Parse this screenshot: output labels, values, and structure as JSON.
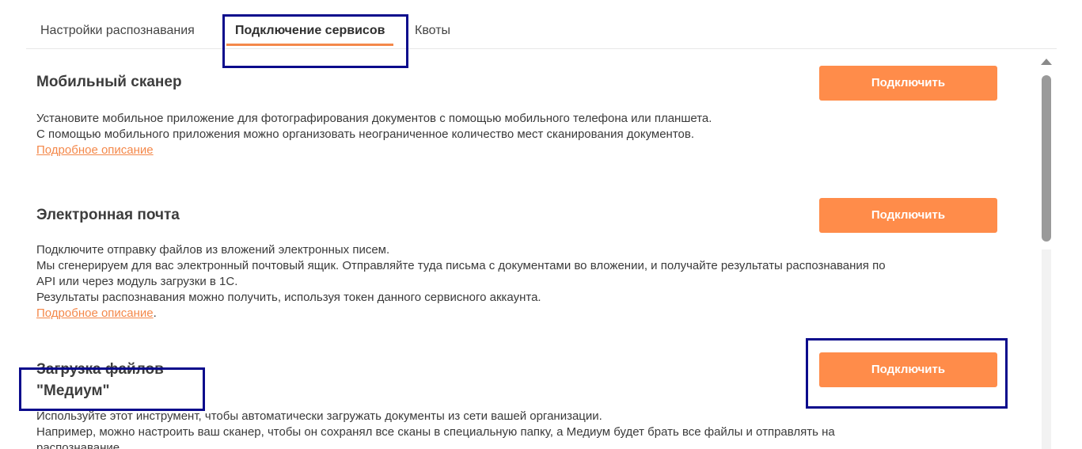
{
  "tabs": {
    "recognition_settings": "Настройки распознавания",
    "service_connection": "Подключение сервисов",
    "quotas": "Квоты"
  },
  "sections": {
    "mobile": {
      "title": "Мобильный сканер",
      "line1": "Установите мобильное приложение для фотографирования документов с помощью мобильного телефона или планшета.",
      "line2": "С помощью мобильного приложения можно организовать неограниченное количество мест сканирования документов.",
      "link": "Подробное описание",
      "button": "Подключить"
    },
    "email": {
      "title": "Электронная почта",
      "line1": "Подключите отправку файлов из вложений электронных писем.",
      "line2": "Мы сгенерируем для вас электронный почтовый ящик. Отправляйте туда письма с документами во вложении, и получайте результаты распознавания по",
      "line3": "API или через модуль загрузки в 1С.",
      "line4": "Результаты распознавания можно получить, используя токен данного сервисного аккаунта.",
      "link": "Подробное описание",
      "link_suffix": ".",
      "button": "Подключить"
    },
    "upload": {
      "title": "Загрузка файлов \"Медиум\"",
      "line1": "Используйте этот инструмент, чтобы автоматически загружать документы из сети вашей организации.",
      "line2": "Например, можно настроить ваш сканер, чтобы он сохранял все сканы в специальную папку, а Медиум будет брать все файлы и отправлять на",
      "line3": "распознавание.",
      "button": "Подключить"
    }
  },
  "colors": {
    "accent": "#ff8c4a",
    "link": "#f4884a",
    "highlight": "#0b0b8c"
  }
}
